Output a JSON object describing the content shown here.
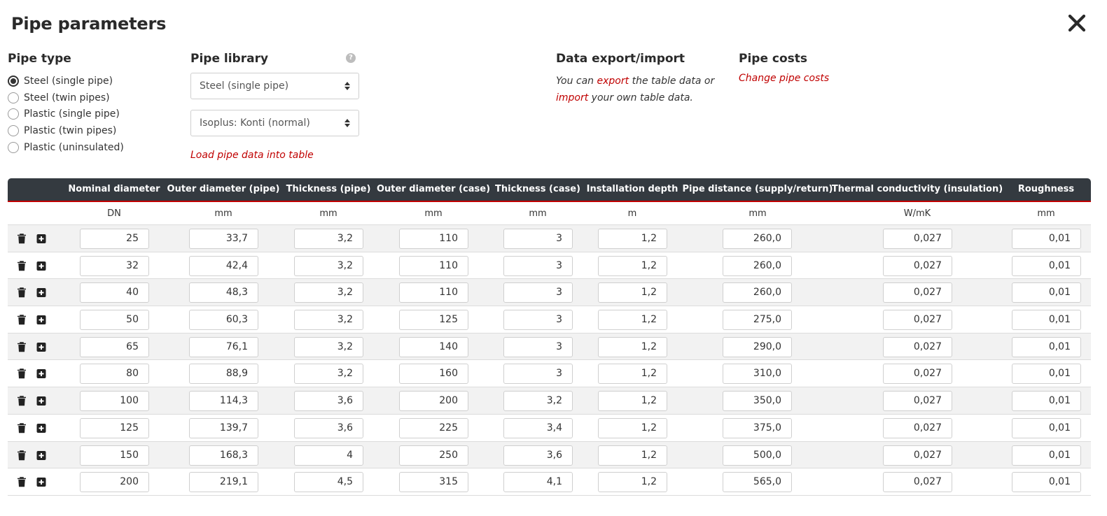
{
  "title": "Pipe parameters",
  "pipe_type": {
    "heading": "Pipe type",
    "options": [
      {
        "label": "Steel (single pipe)",
        "checked": true
      },
      {
        "label": "Steel (twin pipes)",
        "checked": false
      },
      {
        "label": "Plastic (single pipe)",
        "checked": false
      },
      {
        "label": "Plastic (twin pipes)",
        "checked": false
      },
      {
        "label": "Plastic (uninsulated)",
        "checked": false
      }
    ]
  },
  "pipe_library": {
    "heading": "Pipe library",
    "help_glyph": "?",
    "type_select": "Steel (single pipe)",
    "product_select": "Isoplus: Konti (normal)",
    "load_link": "Load pipe data into table"
  },
  "export_import": {
    "heading": "Data export/import",
    "text_1": "You can ",
    "export_link": "export",
    "text_2": " the table data or",
    "import_link": "import",
    "text_3": " your own table data."
  },
  "pipe_costs": {
    "heading": "Pipe costs",
    "link": "Change pipe costs"
  },
  "table": {
    "headers": [
      "Nominal diameter",
      "Outer diameter (pipe)",
      "Thickness (pipe)",
      "Outer diameter (case)",
      "Thickness (case)",
      "Installation depth",
      "Pipe distance (supply/return)",
      "Thermal conductivity (insulation)",
      "Roughness"
    ],
    "units": [
      "DN",
      "mm",
      "mm",
      "mm",
      "mm",
      "m",
      "mm",
      "W/mK",
      "mm"
    ],
    "rows": [
      [
        "25",
        "33,7",
        "3,2",
        "110",
        "3",
        "1,2",
        "260,0",
        "0,027",
        "0,01"
      ],
      [
        "32",
        "42,4",
        "3,2",
        "110",
        "3",
        "1,2",
        "260,0",
        "0,027",
        "0,01"
      ],
      [
        "40",
        "48,3",
        "3,2",
        "110",
        "3",
        "1,2",
        "260,0",
        "0,027",
        "0,01"
      ],
      [
        "50",
        "60,3",
        "3,2",
        "125",
        "3",
        "1,2",
        "275,0",
        "0,027",
        "0,01"
      ],
      [
        "65",
        "76,1",
        "3,2",
        "140",
        "3",
        "1,2",
        "290,0",
        "0,027",
        "0,01"
      ],
      [
        "80",
        "88,9",
        "3,2",
        "160",
        "3",
        "1,2",
        "310,0",
        "0,027",
        "0,01"
      ],
      [
        "100",
        "114,3",
        "3,6",
        "200",
        "3,2",
        "1,2",
        "350,0",
        "0,027",
        "0,01"
      ],
      [
        "125",
        "139,7",
        "3,6",
        "225",
        "3,4",
        "1,2",
        "375,0",
        "0,027",
        "0,01"
      ],
      [
        "150",
        "168,3",
        "4",
        "250",
        "3,6",
        "1,2",
        "500,0",
        "0,027",
        "0,01"
      ],
      [
        "200",
        "219,1",
        "4,5",
        "315",
        "4,1",
        "1,2",
        "565,0",
        "0,027",
        "0,01"
      ]
    ],
    "row_icons": [
      "trash-icon",
      "add-row-icon"
    ]
  }
}
